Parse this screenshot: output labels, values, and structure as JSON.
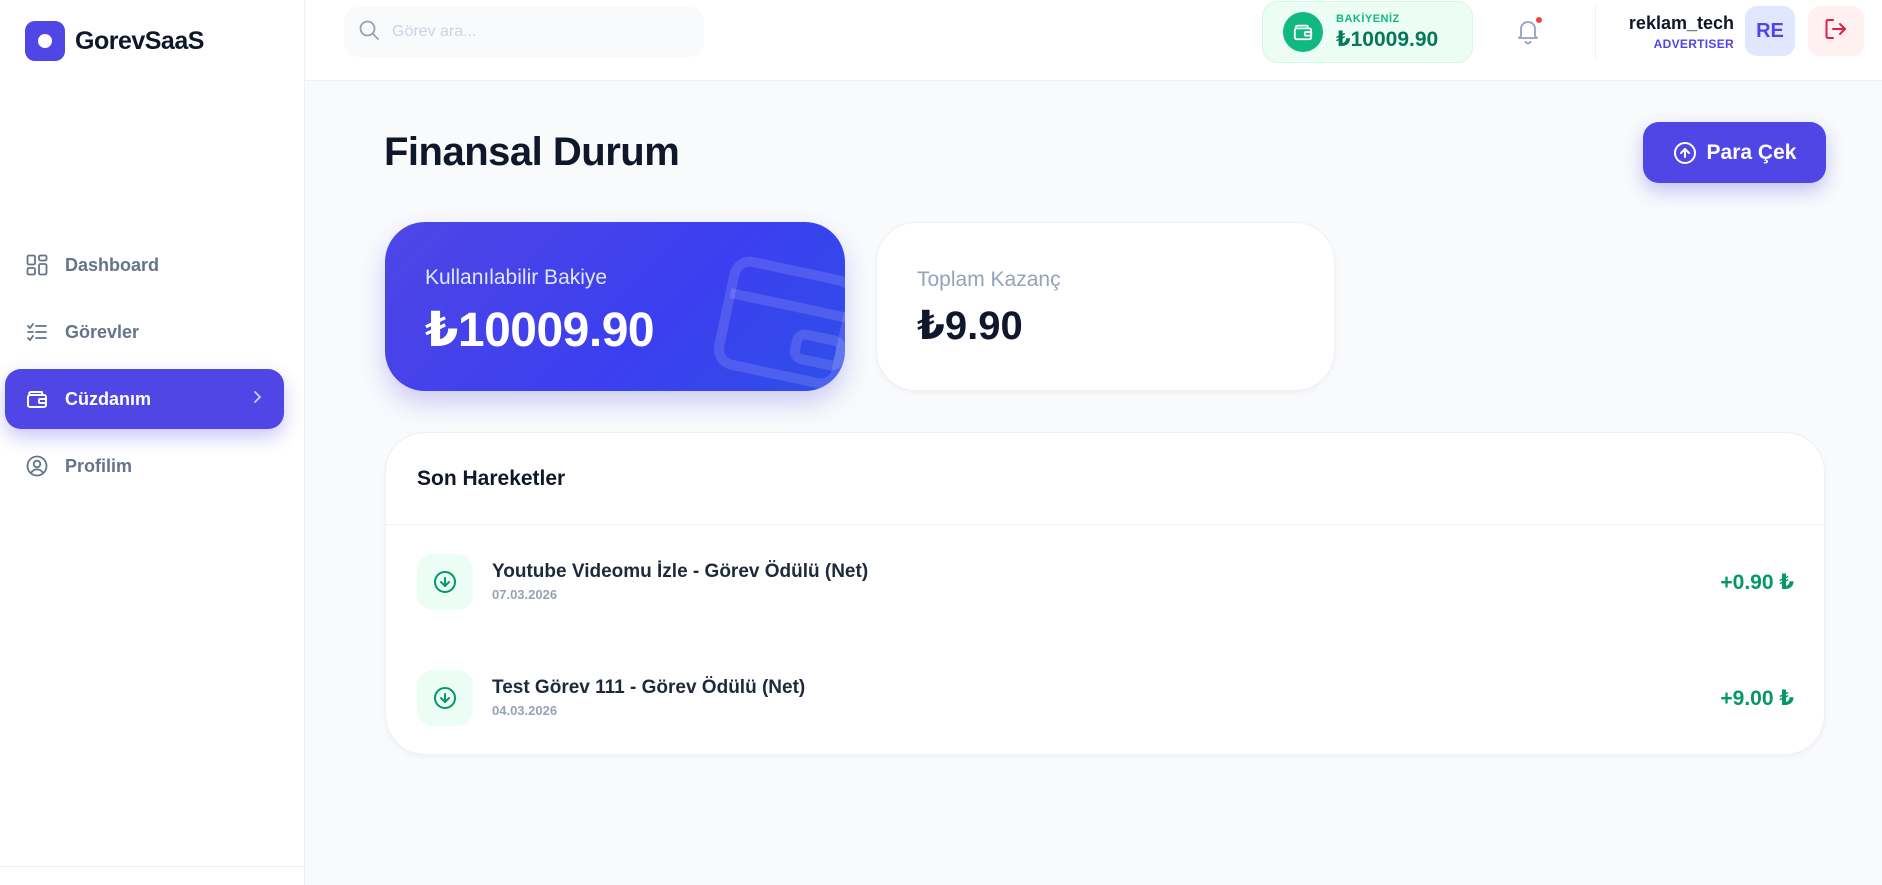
{
  "brand": {
    "name": "GorevSaaS"
  },
  "sidebar": {
    "items": [
      {
        "label": "Dashboard",
        "icon": "dashboard-icon"
      },
      {
        "label": "Görevler",
        "icon": "task-list-icon"
      },
      {
        "label": "Cüzdanım",
        "icon": "wallet-icon",
        "active": true
      },
      {
        "label": "Profilim",
        "icon": "user-circle-icon"
      }
    ]
  },
  "topbar": {
    "search_placeholder": "Görev ara...",
    "balance_label": "BAKİYENİZ",
    "balance_value": "₺10009.90",
    "user_name": "reklam_tech",
    "user_role": "ADVERTISER",
    "avatar_initials": "RE"
  },
  "main": {
    "title": "Finansal Durum",
    "withdraw_label": "Para Çek",
    "available_label": "Kullanılabilir Bakiye",
    "available_value": "₺10009.90",
    "earnings_label": "Toplam Kazanç",
    "earnings_value": "₺9.90"
  },
  "transactions": {
    "title": "Son Hareketler",
    "rows": [
      {
        "title": "Youtube Videomu İzle - Görev Ödülü (Net)",
        "date": "07.03.2026",
        "amount": "+0.90 ₺"
      },
      {
        "title": "Test Görev 111 - Görev Ödülü (Net)",
        "date": "04.03.2026",
        "amount": "+9.00 ₺"
      }
    ]
  },
  "colors": {
    "accent": "#4f46e5",
    "success": "#059669",
    "danger": "#e11d48"
  }
}
